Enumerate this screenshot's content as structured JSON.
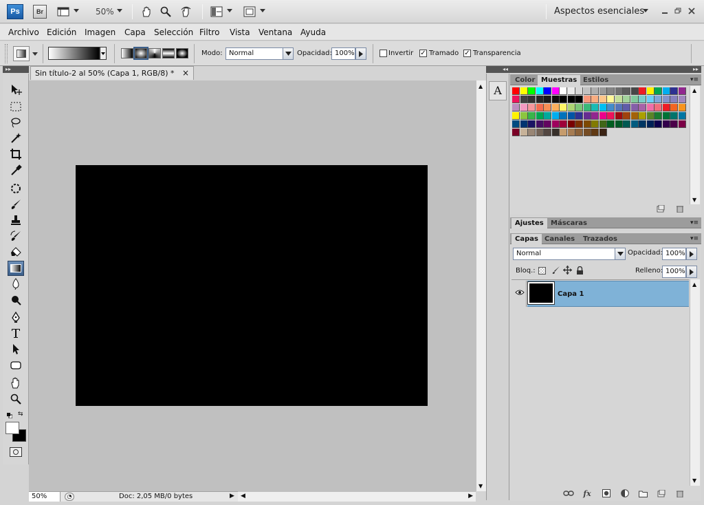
{
  "app": {
    "logo": "Ps",
    "bridge_logo": "Br",
    "zoom": "50%",
    "workspace": "Aspectos esenciales"
  },
  "menu": [
    "Archivo",
    "Edición",
    "Imagen",
    "Capa",
    "Selección",
    "Filtro",
    "Vista",
    "Ventana",
    "Ayuda"
  ],
  "options": {
    "mode_label": "Modo:",
    "mode_value": "Normal",
    "opacity_label": "Opacidad:",
    "opacity_value": "100%",
    "invert_label": "Invertir",
    "invert_checked": false,
    "dither_label": "Tramado",
    "dither_checked": true,
    "transparency_label": "Transparencia",
    "transparency_checked": true
  },
  "document": {
    "tab_title": "Sin título-2 al 50% (Capa 1, RGB/8) *",
    "close": "×",
    "status_zoom": "50%",
    "status_doc": "Doc: 2,05 MB/0 bytes",
    "canvas_color": "#000000"
  },
  "middock": {
    "character_icon": "A"
  },
  "swatches_panel": {
    "tabs": [
      "Color",
      "Muestras",
      "Estilos"
    ],
    "active_tab": "Muestras",
    "colors": [
      "#ff0000",
      "#ffff00",
      "#00ff00",
      "#00ffff",
      "#0000ff",
      "#ff00ff",
      "#ffffff",
      "#ebebeb",
      "#d6d6d6",
      "#c2c2c2",
      "#adadad",
      "#999999",
      "#858585",
      "#707070",
      "#5c5c5c",
      "#474747",
      "#ee1c24",
      "#fff200",
      "#00a651",
      "#00aeef",
      "#2e3192",
      "#92278f",
      "#ed145b",
      "#404040",
      "#333333",
      "#262626",
      "#1a1a1a",
      "#0d0d0d",
      "#000000",
      "#000000",
      "#000000",
      "#f7977a",
      "#f9ad81",
      "#fdc68a",
      "#fff79a",
      "#c4df9b",
      "#a3d39c",
      "#82ca9d",
      "#7bcdc8",
      "#6ecff6",
      "#7ea7d8",
      "#8493ca",
      "#8882be",
      "#a187be",
      "#bc8dbf",
      "#f49ac2",
      "#f6989d",
      "#f26c4f",
      "#f68e55",
      "#fbaf5c",
      "#fff467",
      "#acd372",
      "#7cc576",
      "#3bb878",
      "#1abbb4",
      "#00bff3",
      "#438ccb",
      "#5574b9",
      "#605ca8",
      "#855fa8",
      "#a763a8",
      "#f06ea9",
      "#f26d7d",
      "#ed1c24",
      "#f26522",
      "#f7941d",
      "#fff200",
      "#8dc63f",
      "#39b54a",
      "#00a651",
      "#00a99d",
      "#00aeef",
      "#0072bc",
      "#0054a6",
      "#2e3192",
      "#662d91",
      "#92278f",
      "#ec008c",
      "#ed145b",
      "#9e0b0f",
      "#a0410d",
      "#a36209",
      "#aba000",
      "#598527",
      "#1a7b30",
      "#007236",
      "#00746b",
      "#0076a3",
      "#004b80",
      "#003471",
      "#1b1464",
      "#440e62",
      "#630460",
      "#9e005d",
      "#9e0039",
      "#790000",
      "#7b2e00",
      "#7d4900",
      "#827b00",
      "#406618",
      "#005e20",
      "#005826",
      "#005952",
      "#005b7f",
      "#003663",
      "#002157",
      "#0d004c",
      "#32004b",
      "#4b0049",
      "#7b0046",
      "#7a0026",
      "#c7b299",
      "#998675",
      "#736357",
      "#534741",
      "#37302a",
      "#c69c6d",
      "#a67c52",
      "#8c6239",
      "#754c24",
      "#603913",
      "#3c2415"
    ]
  },
  "adjust_panel": {
    "tabs": [
      "Ajustes",
      "Máscaras"
    ],
    "active_tab": "Ajustes"
  },
  "layers_panel": {
    "tabs": [
      "Capas",
      "Canales",
      "Trazados"
    ],
    "active_tab": "Capas",
    "blend_mode": "Normal",
    "opacity_label": "Opacidad:",
    "opacity_value": "100%",
    "lock_label": "Bloq.:",
    "fill_label": "Relleno:",
    "fill_value": "100%",
    "layers": [
      {
        "name": "Capa 1",
        "visible": true,
        "selected": true
      }
    ],
    "footer_icons": [
      "link-icon",
      "fx-icon",
      "mask-icon",
      "adjustment-icon",
      "folder-icon",
      "new-layer-icon",
      "trash-icon"
    ],
    "fx_label": "fx"
  },
  "colors": {
    "selection": "#7fb2d7",
    "accent": "#3c5f8a"
  }
}
